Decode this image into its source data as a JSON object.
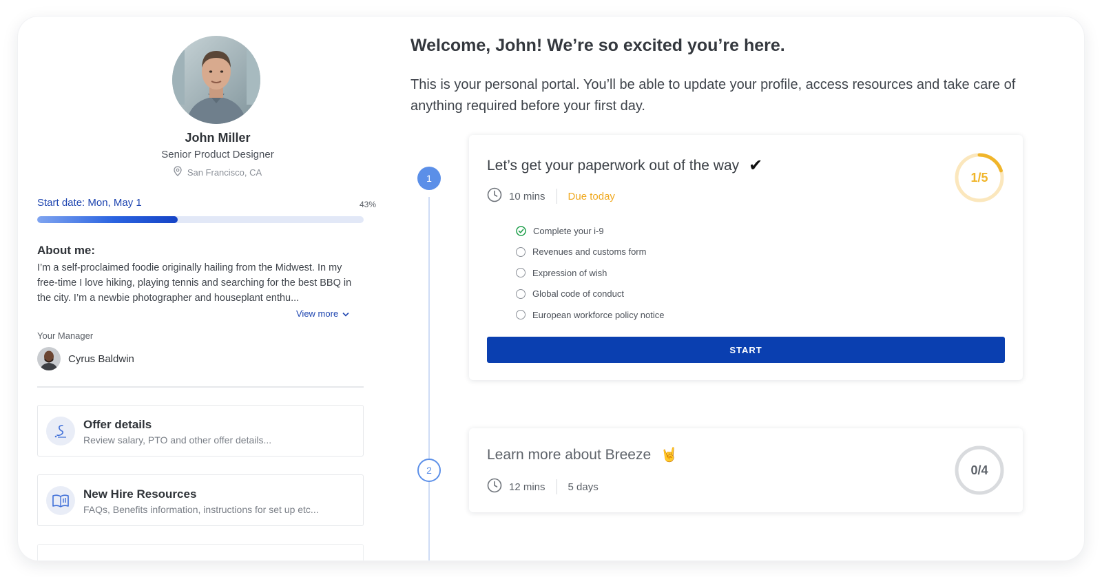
{
  "profile": {
    "name": "John Miller",
    "title": "Senior Product Designer",
    "location": "San Francisco, CA",
    "start_date": "Start date: Mon, May 1",
    "progress_label": "43%",
    "progress": 0.43
  },
  "about": {
    "heading": "About me:",
    "text": "I’m a self-proclaimed foodie originally hailing from the Midwest. In my free-time I love hiking, playing tennis and searching for the best BBQ in the city. I’m a newbie photographer and houseplant enthu...",
    "view_more": "View more"
  },
  "manager": {
    "label": "Your Manager",
    "name": "Cyrus Baldwin"
  },
  "links": [
    {
      "title": "Offer details",
      "subtitle": "Review salary, PTO and other offer details..."
    },
    {
      "title": "New Hire Resources",
      "subtitle": "FAQs, Benefits information, instructions for set up etc..."
    }
  ],
  "welcome": {
    "heading": "Welcome, John! We’re so excited you’re here.",
    "intro": "This is your personal portal. You’ll be able to update your profile, access resources and take care of anything required before your first day."
  },
  "tasks": [
    {
      "step": "1",
      "title": "Let’s get your paperwork out of the way",
      "title_mark": "✔",
      "duration": "10 mins",
      "due": "Due today",
      "progress_label": "1/5",
      "progress": 0.2,
      "ring_color": "#f0b52a",
      "ring_track": "#fbe7bd",
      "checklist": [
        {
          "label": "Complete your i-9",
          "done": true
        },
        {
          "label": "Revenues and customs form",
          "done": false
        },
        {
          "label": "Expression of wish",
          "done": false
        },
        {
          "label": "Global code of conduct",
          "done": false
        },
        {
          "label": "European workforce policy notice",
          "done": false
        }
      ],
      "button": "START"
    },
    {
      "step": "2",
      "title": "Learn more about Breeze",
      "title_mark": "🤘",
      "duration": "12 mins",
      "due": "5 days",
      "progress_label": "0/4",
      "progress": 0,
      "ring_color": "#5e636a",
      "ring_track": "#d9dbde"
    }
  ],
  "colors": {
    "accent": "#0a3fb0",
    "link": "#1e45b0",
    "timeline": "#5b8fe8",
    "due": "#f0a81e",
    "done_check": "#1e9e4a"
  }
}
